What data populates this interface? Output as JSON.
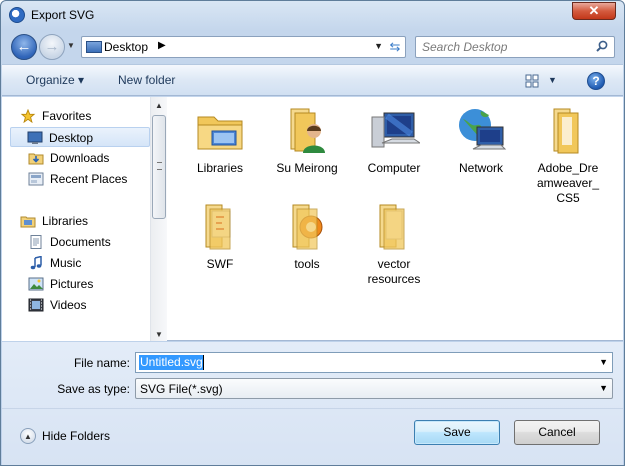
{
  "window": {
    "title": "Export SVG",
    "close_label": "✕"
  },
  "nav": {
    "address": {
      "location": "Desktop"
    },
    "search": {
      "placeholder": "Search Desktop"
    }
  },
  "toolbar": {
    "organize_label": "Organize ▾",
    "new_folder_label": "New folder",
    "help_label": "?"
  },
  "sidebar": {
    "favorites": {
      "label": "Favorites",
      "items": [
        {
          "label": "Desktop",
          "selected": true
        },
        {
          "label": "Downloads"
        },
        {
          "label": "Recent Places"
        }
      ]
    },
    "libraries": {
      "label": "Libraries",
      "items": [
        {
          "label": "Documents"
        },
        {
          "label": "Music"
        },
        {
          "label": "Pictures"
        },
        {
          "label": "Videos"
        }
      ]
    }
  },
  "files": [
    {
      "label": "Libraries",
      "icon": "libraries-folder-icon"
    },
    {
      "label": "Su Meirong",
      "icon": "user-folder-icon"
    },
    {
      "label": "Computer",
      "icon": "computer-icon"
    },
    {
      "label": "Network",
      "icon": "network-icon"
    },
    {
      "label": "Adobe_Dreamweaver_CS5",
      "display": [
        "Adobe_Dre",
        "amweaver_",
        "CS5"
      ],
      "icon": "folder-icon"
    },
    {
      "label": "SWF",
      "icon": "folder-icon"
    },
    {
      "label": "tools",
      "icon": "folder-icon"
    },
    {
      "label": "vector resources",
      "display": [
        "vector",
        "resources"
      ],
      "icon": "folder-icon"
    }
  ],
  "form": {
    "file_name_label": "File name:",
    "file_name_value": "Untitled.svg",
    "save_as_type_label": "Save as type:",
    "save_as_type_value": "SVG File(*.svg)"
  },
  "footer": {
    "hide_folders_label": "Hide Folders",
    "save_label": "Save",
    "cancel_label": "Cancel"
  }
}
